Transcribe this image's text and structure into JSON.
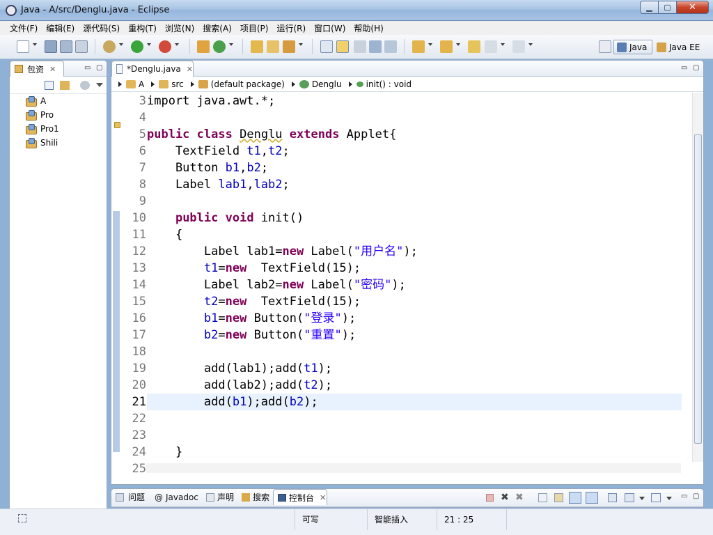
{
  "window": {
    "title": "Java  -  A/src/Denglu.java  -  Eclipse"
  },
  "menu": [
    "文件(F)",
    "编辑(E)",
    "源代码(S)",
    "重构(T)",
    "浏览(N)",
    "搜索(A)",
    "项目(P)",
    "运行(R)",
    "窗口(W)",
    "帮助(H)"
  ],
  "perspectives": {
    "java": "Java",
    "javaee": "Java EE"
  },
  "package_explorer": {
    "tab_label": "包资",
    "projects": [
      "A",
      "Pro",
      "Pro1",
      "Shili"
    ]
  },
  "editor": {
    "tab_label": "*Denglu.java",
    "breadcrumb": [
      "A",
      "src",
      "(default package)",
      "Denglu",
      "init() : void"
    ],
    "line_numbers": [
      "3",
      "4",
      "5",
      "6",
      "7",
      "8",
      "9",
      "10",
      "11",
      "12",
      "13",
      "14",
      "15",
      "16",
      "17",
      "18",
      "19",
      "20",
      "21",
      "22",
      "23",
      "24",
      "25"
    ],
    "current_line": "21"
  },
  "bottom_tabs": [
    "问题",
    "Javadoc",
    "声明",
    "搜索",
    "控制台"
  ],
  "status": {
    "mode": "可写",
    "insert": "智能插入",
    "position": "21 : 25"
  }
}
